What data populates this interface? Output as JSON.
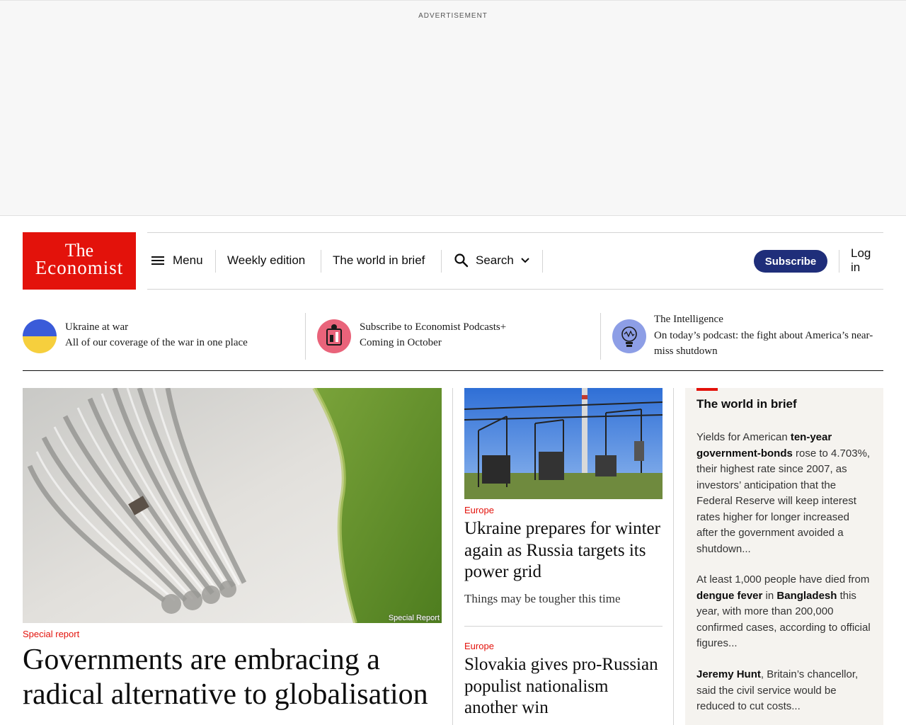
{
  "ad": {
    "label": "ADVERTISEMENT"
  },
  "logo": {
    "line1": "The",
    "line2": "Economist"
  },
  "nav": {
    "menu": "Menu",
    "weekly": "Weekly edition",
    "brief": "The world in brief",
    "search": "Search",
    "subscribe": "Subscribe",
    "login": "Log in"
  },
  "promos": [
    {
      "title": "Ukraine at war",
      "subtitle": "All of our coverage of the war in one place"
    },
    {
      "title": "Subscribe to Economist Podcasts+",
      "subtitle": "Coming in October"
    },
    {
      "title": "The Intelligence",
      "subtitle": "On today’s podcast: the fight about America’s near-miss shutdown"
    }
  ],
  "lead": {
    "image_caption": "Special Report",
    "kicker": "Special report",
    "headline": "Governments are embracing a radical alternative to globalisation"
  },
  "middle": [
    {
      "kicker": "Europe",
      "headline": "Ukraine prepares for winter again as Russia targets its power grid",
      "subtitle": "Things may be tougher this time"
    },
    {
      "kicker": "Europe",
      "headline": "Slovakia gives pro-Russian populist nationalism another win"
    }
  ],
  "brief": {
    "title": "The world in brief",
    "items": [
      {
        "t1": "Yields for American ",
        "b1": "ten-year government-bonds",
        "t2": " rose to 4.703%, their highest rate since 2007, as investors’ anticipation that the Federal Reserve will keep interest rates higher for longer increased after the government avoided a shutdown..."
      },
      {
        "t1": "At least 1,000 people have died from ",
        "b1": "dengue fever",
        "t2": " in ",
        "b2": "Bangladesh",
        "t3": " this year, with more than 200,000 confirmed cases, according to official figures..."
      },
      {
        "b1": "Jeremy Hunt",
        "t2": ", Britain’s chancellor, said the civil service would be reduced to cut costs..."
      }
    ]
  },
  "colors": {
    "brand_red": "#e3120b",
    "subscribe_blue": "#1f2e7a",
    "brief_bg": "#f5f3ef"
  }
}
